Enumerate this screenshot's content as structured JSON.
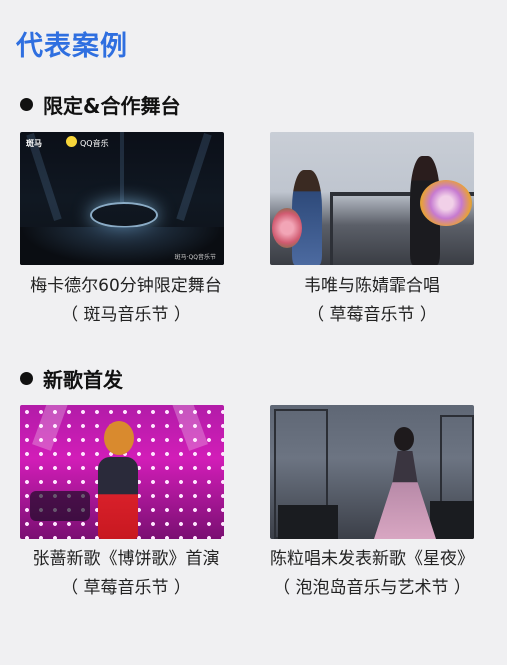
{
  "page": {
    "title": "代表案例",
    "accent_color": "#2f6fe0"
  },
  "sections": [
    {
      "title": "限定&合作舞台",
      "items": [
        {
          "line1": "梅卡德尔60分钟限定舞台",
          "line2": "（ 斑马音乐节 ）",
          "image_desc_icon": "concert-stage-photo",
          "overlay": {
            "logo": "斑马",
            "partner": "QQ音乐",
            "tag": "斑马·QQ音乐节"
          }
        },
        {
          "line1": "韦唯与陈婧霏合唱",
          "line2": "（ 草莓音乐节 ）",
          "image_desc_icon": "duet-performance-photo"
        }
      ]
    },
    {
      "title": "新歌首发",
      "items": [
        {
          "line1": "张蔷新歌《博饼歌》首演",
          "line2": "（ 草莓音乐节 ）",
          "image_desc_icon": "singer-pink-stage-photo"
        },
        {
          "line1": "陈粒唱未发表新歌《星夜》",
          "line2": "（ 泡泡岛音乐与艺术节 ）",
          "image_desc_icon": "singer-gown-stage-photo"
        }
      ]
    }
  ]
}
